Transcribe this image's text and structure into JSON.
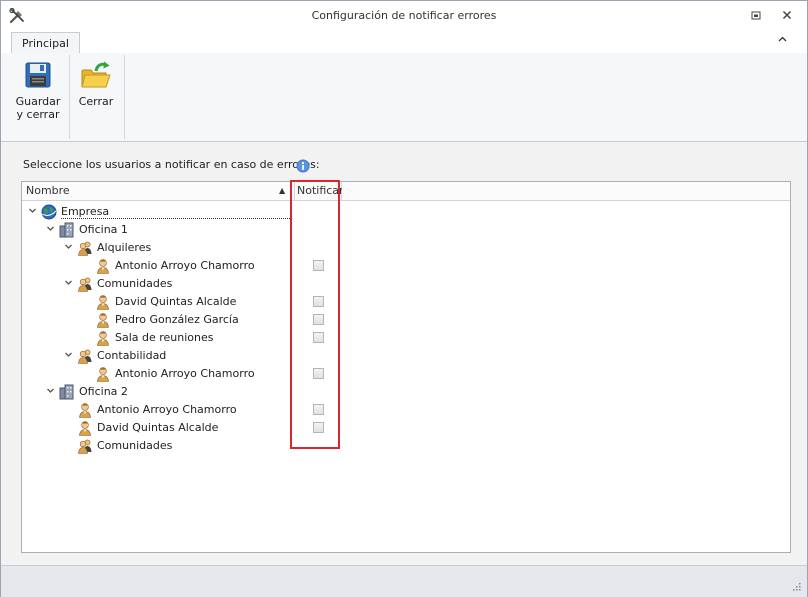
{
  "window": {
    "title": "Configuración de notificar errores",
    "app_icon": "tools-icon",
    "restore_icon": "restore-icon",
    "close_icon": "close-icon"
  },
  "tabs": [
    {
      "label": "Principal"
    }
  ],
  "ribbon": {
    "buttons": [
      {
        "label_line1": "Guardar",
        "label_line2": "y cerrar",
        "icon": "floppy-disk-icon"
      },
      {
        "label_line1": "Cerrar",
        "icon": "open-folder-icon"
      }
    ]
  },
  "prompt": "Seleccione los usuarios a notificar en caso de errores:",
  "tree": {
    "columns": [
      "Nombre",
      "Notificar"
    ],
    "nodes": [
      {
        "label": "Empresa",
        "icon": "globe-icon",
        "level": 0,
        "expanded": true,
        "checkbox": false
      },
      {
        "label": "Oficina 1",
        "icon": "office-icon",
        "level": 1,
        "expanded": true,
        "checkbox": false
      },
      {
        "label": "Alquileres",
        "icon": "group-icon",
        "level": 2,
        "expanded": true,
        "checkbox": false
      },
      {
        "label": "Antonio Arroyo Chamorro",
        "icon": "user-icon",
        "level": 3,
        "checkbox": true,
        "checked": false
      },
      {
        "label": "Comunidades",
        "icon": "group-icon",
        "level": 2,
        "expanded": true,
        "checkbox": false
      },
      {
        "label": "David Quintas Alcalde",
        "icon": "user-icon",
        "level": 3,
        "checkbox": true,
        "checked": false
      },
      {
        "label": "Pedro González García",
        "icon": "user-icon",
        "level": 3,
        "checkbox": true,
        "checked": false
      },
      {
        "label": "Sala de reuniones",
        "icon": "user-icon",
        "level": 3,
        "checkbox": true,
        "checked": false
      },
      {
        "label": "Contabilidad",
        "icon": "group-icon",
        "level": 2,
        "expanded": true,
        "checkbox": false
      },
      {
        "label": "Antonio Arroyo Chamorro",
        "icon": "user-icon",
        "level": 3,
        "checkbox": true,
        "checked": false
      },
      {
        "label": "Oficina 2",
        "icon": "office-icon",
        "level": 1,
        "expanded": true,
        "checkbox": false
      },
      {
        "label": "Antonio Arroyo Chamorro",
        "icon": "user-icon",
        "level": 2,
        "checkbox": true,
        "checked": false
      },
      {
        "label": "David Quintas Alcalde",
        "icon": "user-icon",
        "level": 2,
        "checkbox": true,
        "checked": false
      },
      {
        "label": "Comunidades",
        "icon": "group-icon",
        "level": 2,
        "checkbox": false
      }
    ]
  },
  "colors": {
    "highlight_border": "#d9272e",
    "accent_blue": "#2f6fb9"
  }
}
